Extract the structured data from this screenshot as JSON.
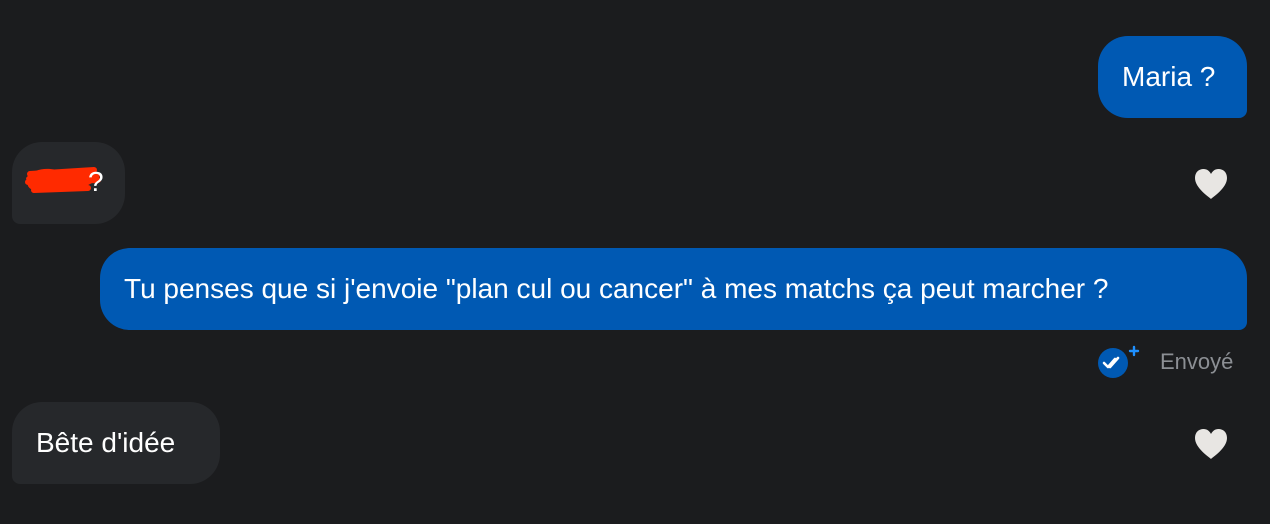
{
  "messages": [
    {
      "direction": "sent",
      "text": "Maria ?"
    },
    {
      "direction": "received",
      "text": "?",
      "redacted": true
    },
    {
      "direction": "sent",
      "text": "Tu penses que si j'envoie \"plan cul ou cancer\" à mes matchs ça peut marcher ?"
    },
    {
      "direction": "received",
      "text": "Bête d'idée"
    }
  ],
  "status": {
    "label": "Envoyé",
    "icon": "double-check-plus-icon"
  },
  "icons": {
    "like": "heart-icon"
  },
  "colors": {
    "background": "#1b1c1e",
    "sent_bubble": "#0059b3",
    "received_bubble": "#26282b",
    "status_text": "#8c8f94",
    "heart": "#e8e6e3",
    "redaction": "#ff2a00",
    "plus_accent": "#1e90ff"
  }
}
